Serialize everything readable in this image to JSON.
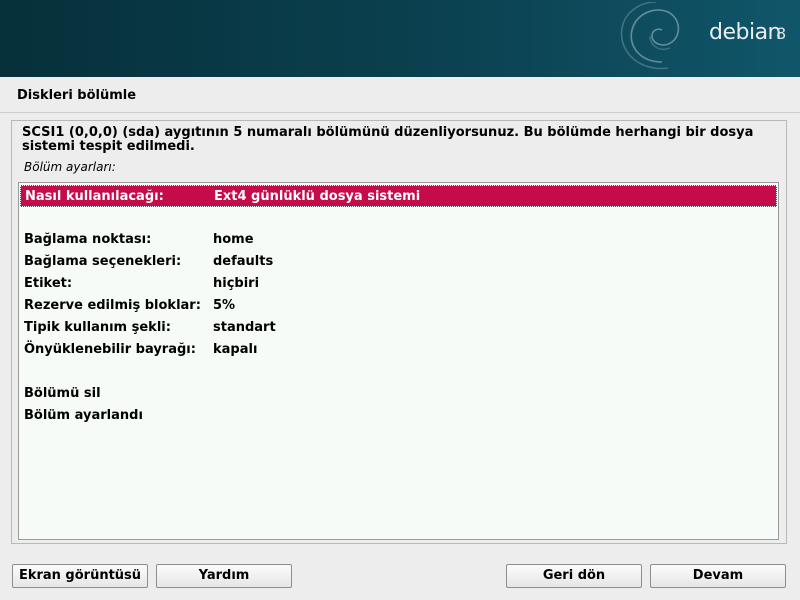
{
  "banner": {
    "logo_text": "debian",
    "logo_version": "8"
  },
  "page_title": "Diskleri bölümle",
  "description": "SCSI1 (0,0,0) (sda) aygıtının 5 numaralı bölümünü düzenliyorsunuz. Bu bölümde herhangi bir dosya sistemi tespit edilmedi.",
  "section_label": "Bölüm ayarları:",
  "settings": [
    {
      "label": "Nasıl kullanılacağı:",
      "value": "Ext4 günlüklü dosya sistemi",
      "selected": true
    },
    {
      "label": "Bağlama noktası:",
      "value": "home"
    },
    {
      "label": "Bağlama seçenekleri:",
      "value": "defaults"
    },
    {
      "label": "Etiket:",
      "value": "hiçbiri"
    },
    {
      "label": "Rezerve edilmiş bloklar:",
      "value": "5%"
    },
    {
      "label": "Tipik kullanım şekli:",
      "value": "standart"
    },
    {
      "label": "Önyüklenebilir bayrağı:",
      "value": "kapalı"
    }
  ],
  "actions": [
    {
      "label": "Bölümü sil"
    },
    {
      "label": "Bölüm ayarlandı"
    }
  ],
  "buttons": {
    "screenshot": "Ekran görüntüsü",
    "help": "Yardım",
    "back": "Geri dön",
    "continue": "Devam"
  },
  "colors": {
    "selection": "#c50b4a",
    "banner": "#0b4150"
  }
}
